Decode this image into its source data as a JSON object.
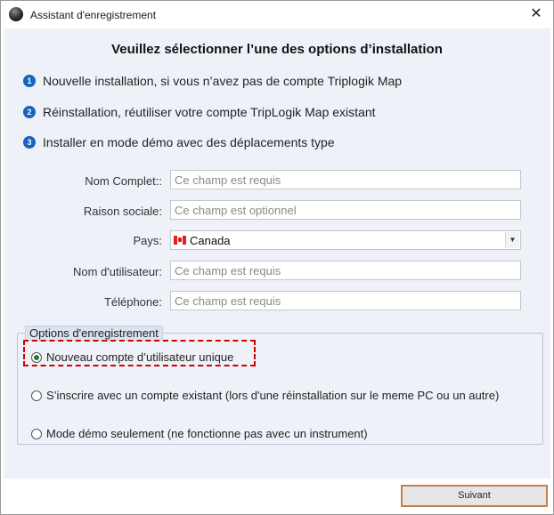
{
  "window": {
    "title": "Assistant d'enregistrement",
    "close_label": "✕"
  },
  "heading": "Veuillez sélectionner l’une des options d’installation",
  "steps": [
    {
      "num": "1",
      "text": "Nouvelle installation, si vous n’avez pas de compte Triplogik Map"
    },
    {
      "num": "2",
      "text": "Réinstallation, réutiliser votre compte TripLogik Map existant"
    },
    {
      "num": "3",
      "text": "Installer en mode démo avec des déplacements type"
    }
  ],
  "form": {
    "full_name": {
      "label": "Nom Complet::",
      "placeholder": "Ce champ est requis"
    },
    "company": {
      "label": "Raison sociale:",
      "placeholder": "Ce champ est optionnel"
    },
    "country": {
      "label": "Pays:",
      "value": "Canada"
    },
    "username": {
      "label": "Nom d'utilisateur:",
      "placeholder": "Ce champ est requis"
    },
    "phone": {
      "label": "Téléphone:",
      "placeholder": "Ce champ est requis"
    }
  },
  "options": {
    "title": "Options d'enregistrement",
    "items": [
      {
        "label": "Nouveau compte d’utilisateur unique",
        "checked": true
      },
      {
        "label": "S’inscrire avec un compte existant (lors d'une réinstallation sur le meme PC ou un autre)",
        "checked": false
      },
      {
        "label": "Mode démo seulement (ne fonctionne pas avec un instrument)",
        "checked": false
      }
    ]
  },
  "footer": {
    "next_label": "Suivant"
  },
  "colors": {
    "content_bg": "#eef2f8",
    "step_badge": "#1565c0",
    "highlight": "#d40000",
    "next_border": "#c08050"
  },
  "icons": {
    "app": "app-orb-icon",
    "close": "close-icon",
    "flag": "canada-flag-icon",
    "dropdown": "chevron-down-icon"
  }
}
